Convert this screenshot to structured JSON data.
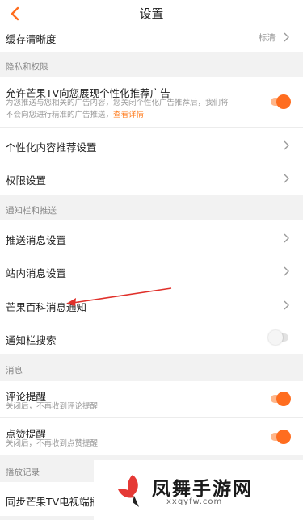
{
  "nav": {
    "title": "设置"
  },
  "rows": {
    "cache_clarity": {
      "label": "缓存清晰度",
      "value": "标清"
    },
    "personalized_ads": {
      "label": "允许芒果TV向您展现个性化推荐广告",
      "desc_line1": "为您推送与您相关的广告内容，您关闭个性化广告推荐后，我们将",
      "desc_line2": "不会向您进行精准的广告推送，",
      "desc_link": "查看详情",
      "toggle": "on"
    },
    "personalized_content": {
      "label": "个性化内容推荐设置"
    },
    "permissions": {
      "label": "权限设置"
    },
    "push_settings": {
      "label": "推送消息设置"
    },
    "inbox_settings": {
      "label": "站内消息设置"
    },
    "wiki_notify": {
      "label": "芒果百科消息通知"
    },
    "notif_search": {
      "label": "通知栏搜索",
      "toggle": "off"
    },
    "comment_remind": {
      "label": "评论提醒",
      "desc": "关闭后，不再收到评论提醒",
      "toggle": "on"
    },
    "like_remind": {
      "label": "点赞提醒",
      "desc": "关闭后，不再收到点赞提醒",
      "toggle": "on"
    },
    "sync_tv": {
      "label": "同步芒果TV电视端播"
    }
  },
  "sections": {
    "privacy": "隐私和权限",
    "notifications": "通知栏和推送",
    "messages": "消息",
    "history": "播放记录"
  },
  "watermark": {
    "text": "凤舞手游网",
    "url": "xxqyfw.com"
  },
  "colors": {
    "accent": "#ff6d1f",
    "annotation_arrow": "#e0302a"
  },
  "icons": {
    "back": "chevron-left-icon",
    "row_arrow": "chevron-right-icon"
  }
}
